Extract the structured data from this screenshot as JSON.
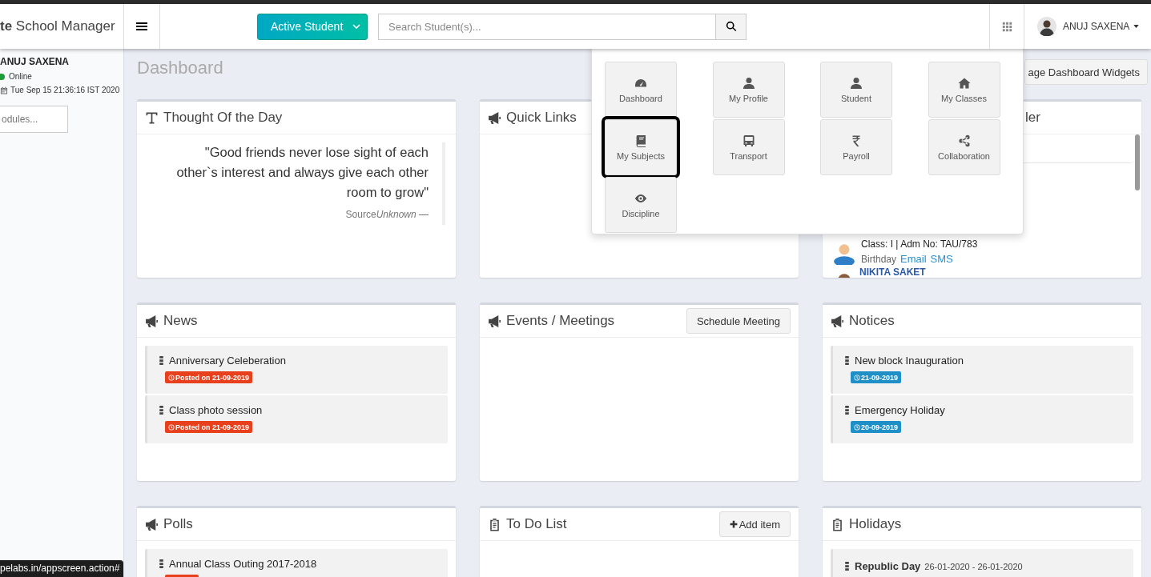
{
  "header": {
    "logo_bold": "te",
    "logo_text": "School Manager",
    "student_filter": "Active Student",
    "search": {
      "placeholder": "Search Student(s)..."
    },
    "user": "ANUJ SAXENA"
  },
  "sidebar": {
    "user": "ANUJ SAXENA",
    "status": "Online",
    "online": true,
    "datetime": "Tue Sep 15 21:36:16 IST 2020",
    "module_search": {
      "placeholder": "odules..."
    }
  },
  "page_title": "Dashboard",
  "manage_button": "age Dashboard Widgets",
  "cards": [
    {
      "kind": "quote",
      "title": "Thought Of the Day",
      "quote": "\"Good friends never lose sight of each other`s interest and always give each other room to grow\"",
      "source": {
        "label": "Source",
        "author": "Unknown —"
      }
    },
    {
      "kind": "links",
      "title": "Quick Links"
    },
    {
      "kind": "birthday",
      "title": "ler",
      "student": {
        "info": "Class: I | Adm No: TAU/783",
        "label": "Birthday",
        "links": [
          "Email",
          "SMS"
        ]
      },
      "next_name": "NIKITA SAKET"
    },
    {
      "kind": "news",
      "title": "News",
      "items": [
        {
          "title": "Anniversary Celeberation",
          "date": "Posted on 21-09-2019"
        },
        {
          "title": "Class photo session",
          "date": "Posted on 21-09-2019"
        }
      ]
    },
    {
      "kind": "events",
      "title": "Events / Meetings",
      "button": "Schedule Meeting"
    },
    {
      "kind": "notices",
      "title": "Notices",
      "items": [
        {
          "title": "New block Inauguration",
          "date": "21-09-2019"
        },
        {
          "title": "Emergency Holiday",
          "date": "20-09-2019"
        }
      ]
    },
    {
      "kind": "polls",
      "title": "Polls",
      "items": [
        {
          "title": "Annual Class Outing 2017-2018"
        }
      ]
    },
    {
      "kind": "todo",
      "title": "To Do List",
      "button": "Add item"
    },
    {
      "kind": "holidays",
      "title": "Holidays",
      "items": [
        {
          "name": "Republic Day",
          "dates": "26-01-2020 - 26-01-2020"
        }
      ]
    }
  ],
  "quick_menu": {
    "tiles": [
      {
        "label": "Dashboard",
        "selected": false
      },
      {
        "label": "My Profile",
        "selected": false
      },
      {
        "label": "Student",
        "selected": false
      },
      {
        "label": "My Classes",
        "selected": false
      },
      {
        "label": "My Subjects",
        "selected": true
      },
      {
        "label": "Transport",
        "selected": false
      },
      {
        "label": "Payroll",
        "selected": false
      },
      {
        "label": "Collaboration",
        "selected": false
      },
      {
        "label": "Discipline",
        "selected": false
      }
    ]
  },
  "status_url": "pelabs.in/appscreen.action#"
}
